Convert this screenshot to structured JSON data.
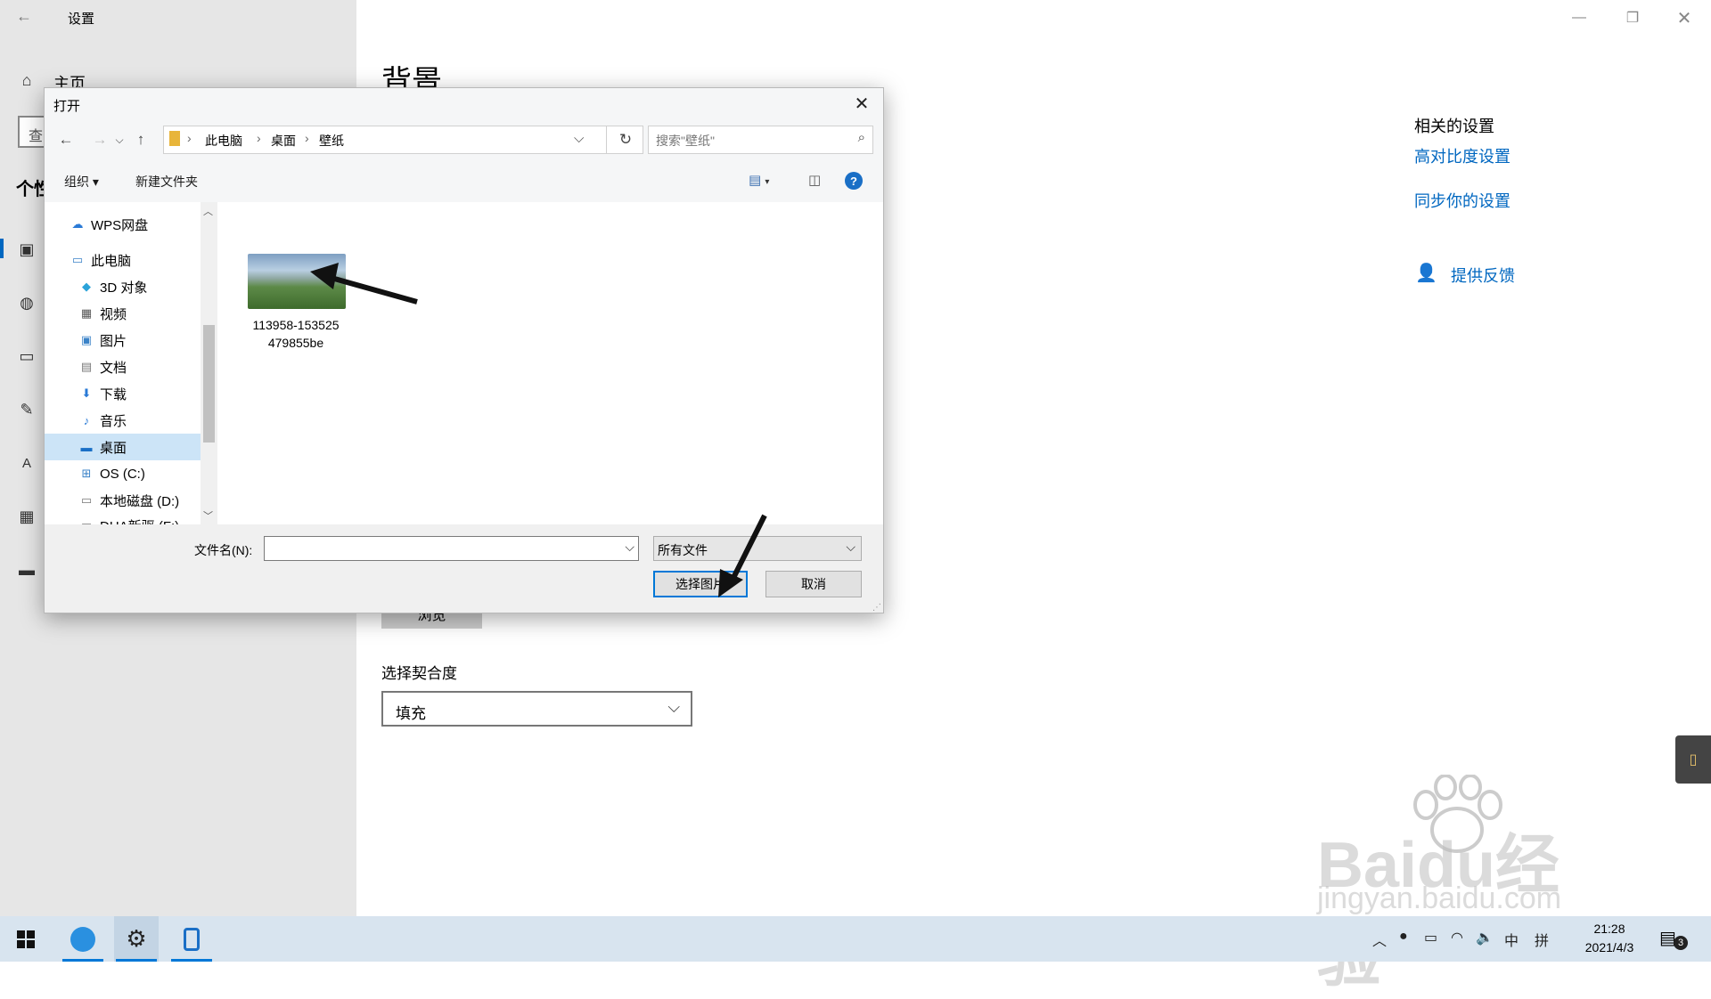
{
  "settings": {
    "window_title": "设置",
    "home_label": "主页",
    "search_placeholder_partial": "查",
    "section_partial": "个性",
    "page_title": "背景",
    "browse_label": "浏览",
    "fit_label": "选择契合度",
    "fit_value": "填充",
    "related_title": "相关的设置",
    "related_links": [
      "高对比度设置",
      "同步你的设置"
    ],
    "feedback_label": "提供反馈"
  },
  "dialog": {
    "title": "打开",
    "breadcrumb": [
      "此电脑",
      "桌面",
      "壁纸"
    ],
    "search_placeholder": "搜索\"壁纸\"",
    "toolbar": {
      "organize": "组织",
      "new_folder": "新建文件夹"
    },
    "tree": [
      {
        "label": "WPS网盘",
        "icon": "cloud-icon"
      },
      {
        "label": "此电脑",
        "icon": "computer-icon"
      },
      {
        "label": "3D 对象",
        "icon": "cube-icon"
      },
      {
        "label": "视频",
        "icon": "video-icon"
      },
      {
        "label": "图片",
        "icon": "picture-icon"
      },
      {
        "label": "文档",
        "icon": "document-icon"
      },
      {
        "label": "下载",
        "icon": "download-icon"
      },
      {
        "label": "音乐",
        "icon": "music-icon"
      },
      {
        "label": "桌面",
        "icon": "desktop-icon",
        "selected": true
      },
      {
        "label": "OS (C:)",
        "icon": "drive-icon"
      },
      {
        "label": "本地磁盘 (D:)",
        "icon": "drive-icon"
      },
      {
        "label": "DHA新驱 (F:)",
        "icon": "drive-icon"
      }
    ],
    "file": {
      "name_line1": "113958-153525",
      "name_line2": "479855be"
    },
    "filename_label": "文件名(N):",
    "filename_value": "",
    "filetype_value": "所有文件",
    "choose_button": "选择图片",
    "cancel_button": "取消"
  },
  "taskbar": {
    "time": "21:28",
    "date": "2021/4/3",
    "ime": "中",
    "ime2": "拼",
    "notification_count": "3"
  },
  "watermark": {
    "brand": "Baidu经验",
    "url": "jingyan.baidu.com"
  }
}
